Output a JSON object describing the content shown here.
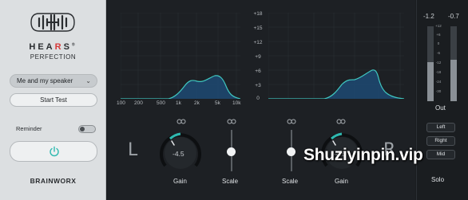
{
  "brand": {
    "name_prefix": "HEA",
    "name_accent": "R",
    "name_suffix": "S",
    "registered": "®",
    "subtitle": "PERFECTION",
    "maker": "BRAINWORX"
  },
  "controls": {
    "profile_dropdown": "Me and my speaker",
    "start_test": "Start Test",
    "reminder_label": "Reminder",
    "reminder_on": false
  },
  "db_scale": [
    "+18",
    "+15",
    "+12",
    "+9",
    "+6",
    "+3",
    "0"
  ],
  "freq_labels": [
    "100",
    "200",
    "500",
    "1k",
    "2k",
    "5k",
    "10k"
  ],
  "left_channel": {
    "letter": "L",
    "gain_value": "-4.5",
    "gain_label": "Gain",
    "scale_label": "Scale"
  },
  "right_channel": {
    "letter": "R",
    "gain_value": "-4.5",
    "gain_label": "Gain",
    "scale_label": "Scale"
  },
  "output": {
    "peak_left": "-1.2",
    "peak_right": "-0.7",
    "meter_scale": [
      "+12",
      "+6",
      "0",
      "-6",
      "-12",
      "-18",
      "-24",
      "-30"
    ],
    "label": "Out",
    "solo_buttons": [
      "Left",
      "Right",
      "Mid"
    ],
    "solo_label": "Solo"
  },
  "watermark": "Shuziyinpin.vip",
  "colors": {
    "accent": "#2fb9b0",
    "curve_fill": "#1d4a73",
    "panel_light": "#dcdfe1",
    "panel_dark": "#1d2024"
  }
}
